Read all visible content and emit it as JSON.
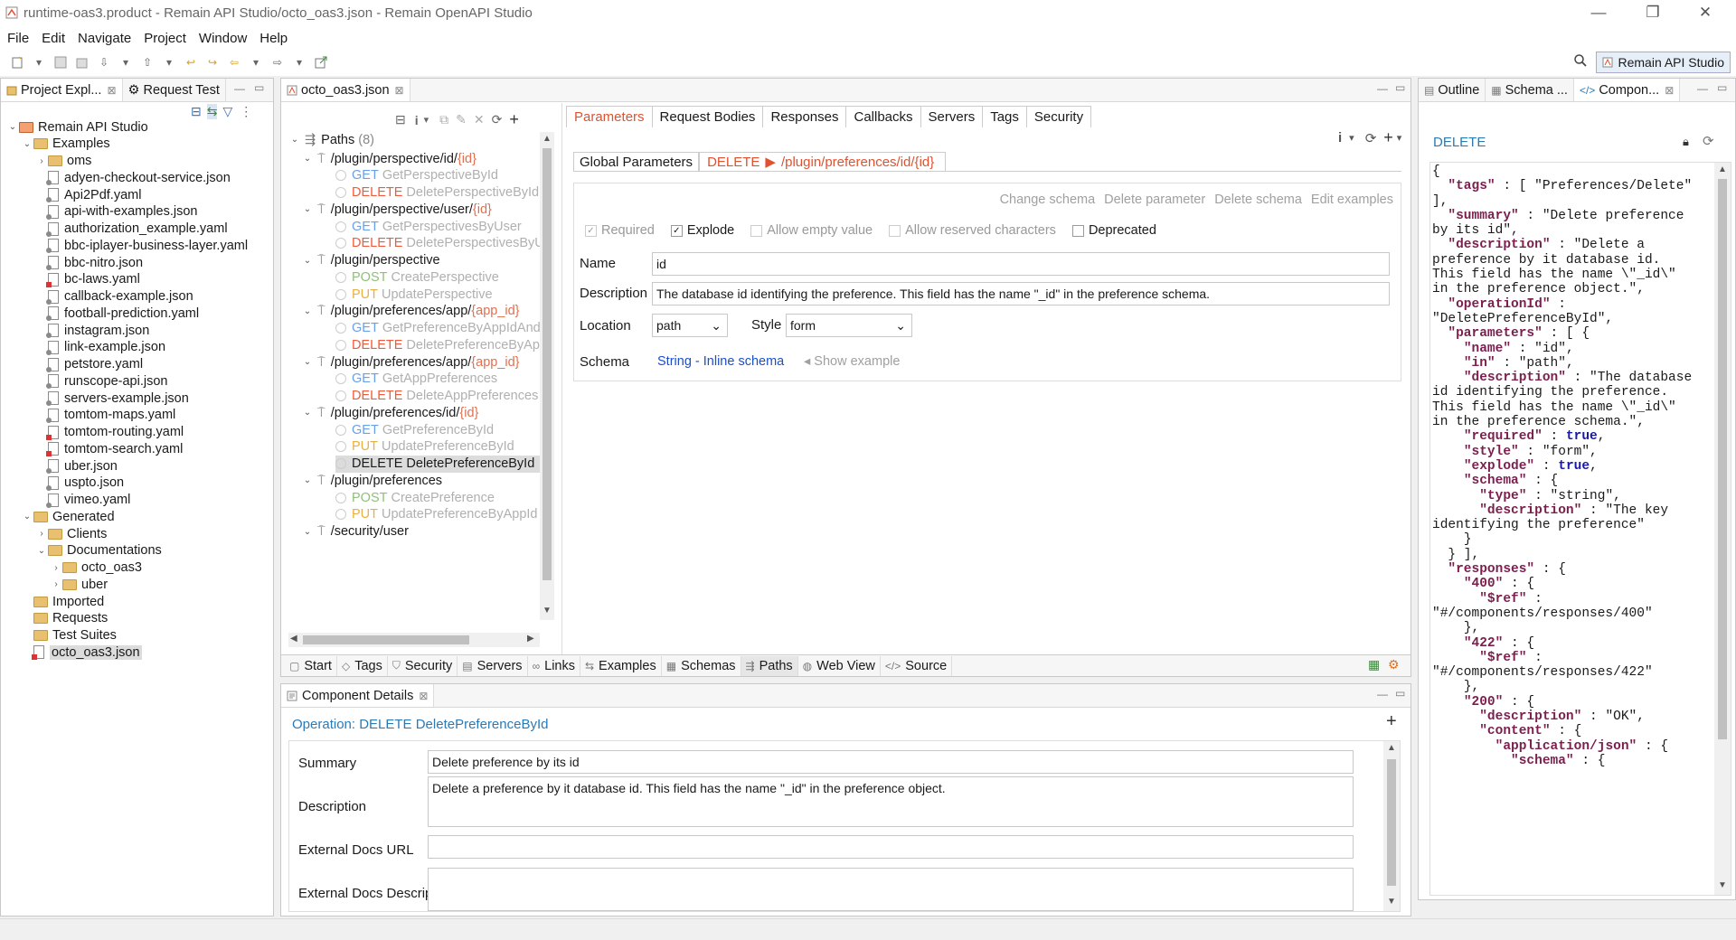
{
  "window": {
    "title": "runtime-oas3.product - Remain API Studio/octo_oas3.json - Remain OpenAPI Studio",
    "minimize": "—",
    "restore": "❐",
    "close": "✕"
  },
  "menu": [
    "File",
    "Edit",
    "Navigate",
    "Project",
    "Window",
    "Help"
  ],
  "perspective": "Remain API Studio",
  "left_panel": {
    "tabs": [
      {
        "label": "Project Expl...",
        "close": "⊠"
      },
      {
        "label": "Request Test"
      }
    ],
    "tree": [
      {
        "label": "Remain API Studio",
        "depth": 0,
        "kind": "project",
        "twist": "⌄"
      },
      {
        "label": "Examples",
        "depth": 1,
        "kind": "folder",
        "twist": "⌄"
      },
      {
        "label": "oms",
        "depth": 2,
        "kind": "folder",
        "twist": "›"
      },
      {
        "label": "adyen-checkout-service.json",
        "depth": 2,
        "kind": "swag"
      },
      {
        "label": "Api2Pdf.yaml",
        "depth": 2,
        "kind": "swag"
      },
      {
        "label": "api-with-examples.json",
        "depth": 2,
        "kind": "swag"
      },
      {
        "label": "authorization_example.yaml",
        "depth": 2,
        "kind": "swag"
      },
      {
        "label": "bbc-iplayer-business-layer.yaml",
        "depth": 2,
        "kind": "swag"
      },
      {
        "label": "bbc-nitro.json",
        "depth": 2,
        "kind": "swag"
      },
      {
        "label": "bc-laws.yaml",
        "depth": 2,
        "kind": "red"
      },
      {
        "label": "callback-example.json",
        "depth": 2,
        "kind": "swag"
      },
      {
        "label": "football-prediction.yaml",
        "depth": 2,
        "kind": "swag"
      },
      {
        "label": "instagram.json",
        "depth": 2,
        "kind": "swag"
      },
      {
        "label": "link-example.json",
        "depth": 2,
        "kind": "swag"
      },
      {
        "label": "petstore.yaml",
        "depth": 2,
        "kind": "swag"
      },
      {
        "label": "runscope-api.json",
        "depth": 2,
        "kind": "swag"
      },
      {
        "label": "servers-example.json",
        "depth": 2,
        "kind": "swag"
      },
      {
        "label": "tomtom-maps.yaml",
        "depth": 2,
        "kind": "swag"
      },
      {
        "label": "tomtom-routing.yaml",
        "depth": 2,
        "kind": "red"
      },
      {
        "label": "tomtom-search.yaml",
        "depth": 2,
        "kind": "red"
      },
      {
        "label": "uber.json",
        "depth": 2,
        "kind": "swag"
      },
      {
        "label": "uspto.json",
        "depth": 2,
        "kind": "swag"
      },
      {
        "label": "vimeo.yaml",
        "depth": 2,
        "kind": "swag"
      },
      {
        "label": "Generated",
        "depth": 1,
        "kind": "folder",
        "twist": "⌄"
      },
      {
        "label": "Clients",
        "depth": 2,
        "kind": "folder",
        "twist": "›"
      },
      {
        "label": "Documentations",
        "depth": 2,
        "kind": "folder",
        "twist": "⌄"
      },
      {
        "label": "octo_oas3",
        "depth": 3,
        "kind": "folder",
        "twist": "›"
      },
      {
        "label": "uber",
        "depth": 3,
        "kind": "folder",
        "twist": "›"
      },
      {
        "label": "Imported",
        "depth": 1,
        "kind": "folder"
      },
      {
        "label": "Requests",
        "depth": 1,
        "kind": "folder"
      },
      {
        "label": "Test Suites",
        "depth": 1,
        "kind": "folder"
      },
      {
        "label": "octo_oas3.json",
        "depth": 1,
        "kind": "red",
        "selected": true
      }
    ]
  },
  "editor": {
    "tab": "octo_oas3.json",
    "tab_close": "⊠",
    "paths_header": "Paths",
    "paths_count": "(8)",
    "paths": [
      {
        "type": "path",
        "prefix": "/plugin/perspective/id/",
        "param": "{id}"
      },
      {
        "type": "op",
        "method": "GET",
        "name": "GetPerspectiveById"
      },
      {
        "type": "op",
        "method": "DELETE",
        "name": "DeletePerspectiveById"
      },
      {
        "type": "path",
        "prefix": "/plugin/perspective/user/",
        "param": "{id}"
      },
      {
        "type": "op",
        "method": "GET",
        "name": "GetPerspectivesByUser"
      },
      {
        "type": "op",
        "method": "DELETE",
        "name": "DeletePerspectivesByUser"
      },
      {
        "type": "path",
        "prefix": "/plugin/perspective",
        "param": ""
      },
      {
        "type": "op",
        "method": "POST",
        "name": "CreatePerspective"
      },
      {
        "type": "op",
        "method": "PUT",
        "name": "UpdatePerspective"
      },
      {
        "type": "path",
        "prefix": "/plugin/preferences/app/",
        "param": "{app_id}"
      },
      {
        "type": "op",
        "method": "GET",
        "name": "GetPreferenceByAppIdAndKey"
      },
      {
        "type": "op",
        "method": "DELETE",
        "name": "DeletePreferenceByAppId"
      },
      {
        "type": "path",
        "prefix": "/plugin/preferences/app/",
        "param": "{app_id}"
      },
      {
        "type": "op",
        "method": "GET",
        "name": "GetAppPreferences"
      },
      {
        "type": "op",
        "method": "DELETE",
        "name": "DeleteAppPreferences"
      },
      {
        "type": "path",
        "prefix": "/plugin/preferences/id/",
        "param": "{id}"
      },
      {
        "type": "op",
        "method": "GET",
        "name": "GetPreferenceById"
      },
      {
        "type": "op",
        "method": "PUT",
        "name": "UpdatePreferenceById"
      },
      {
        "type": "op",
        "method": "DELETE",
        "name": "DeletePreferenceById",
        "selected": true
      },
      {
        "type": "path",
        "prefix": "/plugin/preferences",
        "param": ""
      },
      {
        "type": "op",
        "method": "POST",
        "name": "CreatePreference"
      },
      {
        "type": "op",
        "method": "PUT",
        "name": "UpdatePreferenceByAppId"
      },
      {
        "type": "path",
        "prefix": "/security/user",
        "param": ""
      }
    ],
    "section_tabs": [
      "Parameters",
      "Request Bodies",
      "Responses",
      "Callbacks",
      "Servers",
      "Tags",
      "Security"
    ],
    "crumb_global": "Global Parameters",
    "crumb_method": "DELETE",
    "crumb_arrow": "▶",
    "crumb_path": "/plugin/preferences/id/{id}",
    "actions": [
      "Change schema",
      "Delete parameter",
      "Delete schema",
      "Edit examples"
    ],
    "checks": [
      {
        "label": "Required",
        "checked": true,
        "disabled": true
      },
      {
        "label": "Explode",
        "checked": true,
        "disabled": false
      },
      {
        "label": "Allow empty value",
        "checked": false,
        "disabled": true
      },
      {
        "label": "Allow reserved characters",
        "checked": false,
        "disabled": true
      },
      {
        "label": "Deprecated",
        "checked": false,
        "disabled": false
      }
    ],
    "name_label": "Name",
    "name_value": "id",
    "desc_label": "Description",
    "desc_value": "The database id identifying the preference. This field has the name \"_id\" in the preference schema.",
    "location_label": "Location",
    "location_value": "path",
    "style_label": "Style",
    "style_value": "form",
    "schema_label": "Schema",
    "schema_link": "String - Inline schema",
    "show_example": "◂ Show example",
    "bottom_tabs": [
      {
        "label": "Start",
        "icon": "▢"
      },
      {
        "label": "Tags",
        "icon": "◇"
      },
      {
        "label": "Security",
        "icon": "⛉"
      },
      {
        "label": "Servers",
        "icon": "▤"
      },
      {
        "label": "Links",
        "icon": "∞"
      },
      {
        "label": "Examples",
        "icon": "⇆"
      },
      {
        "label": "Schemas",
        "icon": "▦"
      },
      {
        "label": "Paths",
        "icon": "⇶"
      },
      {
        "label": "Web View",
        "icon": "◍"
      },
      {
        "label": "Source",
        "icon": "</>"
      }
    ]
  },
  "component_details": {
    "tab": "Component Details",
    "tab_close": "⊠",
    "operation": "Operation: DELETE DeletePreferenceById",
    "add": "+",
    "summary_label": "Summary",
    "summary_value": "Delete preference by its id",
    "description_label": "Description",
    "description_value": "Delete a preference by it database id. This field has the name \"_id\" in the preference object.",
    "ext_url_label": "External Docs URL",
    "ext_url_value": "",
    "ext_desc_label": "External Docs Description",
    "ext_desc_value": ""
  },
  "right_panel": {
    "tabs": [
      {
        "label": "Outline"
      },
      {
        "label": "Schema ..."
      },
      {
        "label": "Compon...",
        "close": "⊠"
      }
    ],
    "header": "DELETE",
    "json_lines": [
      [
        [
          "p",
          "{"
        ]
      ],
      [
        [
          "p",
          "  "
        ],
        [
          "k",
          "\"tags\""
        ],
        [
          "p",
          " : [ \"Preferences/Delete\""
        ]
      ],
      [
        [
          "p",
          "],"
        ]
      ],
      [
        [
          "p",
          "  "
        ],
        [
          "k",
          "\"summary\""
        ],
        [
          "p",
          " : \"Delete preference"
        ]
      ],
      [
        [
          "p",
          "by its id\","
        ]
      ],
      [
        [
          "p",
          "  "
        ],
        [
          "k",
          "\"description\""
        ],
        [
          "p",
          " : \"Delete a"
        ]
      ],
      [
        [
          "p",
          "preference by it database id."
        ]
      ],
      [
        [
          "p",
          "This field has the name \\\"_id\\\""
        ]
      ],
      [
        [
          "p",
          "in the preference object.\","
        ]
      ],
      [
        [
          "p",
          "  "
        ],
        [
          "k",
          "\"operationId\""
        ],
        [
          "p",
          " :"
        ]
      ],
      [
        [
          "p",
          "\"DeletePreferenceById\","
        ]
      ],
      [
        [
          "p",
          "  "
        ],
        [
          "k",
          "\"parameters\""
        ],
        [
          "p",
          " : [ {"
        ]
      ],
      [
        [
          "p",
          "    "
        ],
        [
          "k",
          "\"name\""
        ],
        [
          "p",
          " : \"id\","
        ]
      ],
      [
        [
          "p",
          "    "
        ],
        [
          "k",
          "\"in\""
        ],
        [
          "p",
          " : \"path\","
        ]
      ],
      [
        [
          "p",
          "    "
        ],
        [
          "k",
          "\"description\""
        ],
        [
          "p",
          " : \"The database"
        ]
      ],
      [
        [
          "p",
          "id identifying the preference."
        ]
      ],
      [
        [
          "p",
          "This field has the name \\\"_id\\\""
        ]
      ],
      [
        [
          "p",
          "in the preference schema.\","
        ]
      ],
      [
        [
          "p",
          "    "
        ],
        [
          "k",
          "\"required\""
        ],
        [
          "p",
          " : "
        ],
        [
          "b",
          "true"
        ],
        [
          "p",
          ","
        ]
      ],
      [
        [
          "p",
          "    "
        ],
        [
          "k",
          "\"style\""
        ],
        [
          "p",
          " : \"form\","
        ]
      ],
      [
        [
          "p",
          "    "
        ],
        [
          "k",
          "\"explode\""
        ],
        [
          "p",
          " : "
        ],
        [
          "b",
          "true"
        ],
        [
          "p",
          ","
        ]
      ],
      [
        [
          "p",
          "    "
        ],
        [
          "k",
          "\"schema\""
        ],
        [
          "p",
          " : {"
        ]
      ],
      [
        [
          "p",
          "      "
        ],
        [
          "k",
          "\"type\""
        ],
        [
          "p",
          " : \"string\","
        ]
      ],
      [
        [
          "p",
          "      "
        ],
        [
          "k",
          "\"description\""
        ],
        [
          "p",
          " : \"The key"
        ]
      ],
      [
        [
          "p",
          "identifying the preference\""
        ]
      ],
      [
        [
          "p",
          "    }"
        ]
      ],
      [
        [
          "p",
          "  } ],"
        ]
      ],
      [
        [
          "p",
          "  "
        ],
        [
          "k",
          "\"responses\""
        ],
        [
          "p",
          " : {"
        ]
      ],
      [
        [
          "p",
          "    "
        ],
        [
          "k",
          "\"400\""
        ],
        [
          "p",
          " : {"
        ]
      ],
      [
        [
          "p",
          "      "
        ],
        [
          "k",
          "\"$ref\""
        ],
        [
          "p",
          " :"
        ]
      ],
      [
        [
          "p",
          "\"#/components/responses/400\""
        ]
      ],
      [
        [
          "p",
          "    },"
        ]
      ],
      [
        [
          "p",
          "    "
        ],
        [
          "k",
          "\"422\""
        ],
        [
          "p",
          " : {"
        ]
      ],
      [
        [
          "p",
          "      "
        ],
        [
          "k",
          "\"$ref\""
        ],
        [
          "p",
          " :"
        ]
      ],
      [
        [
          "p",
          "\"#/components/responses/422\""
        ]
      ],
      [
        [
          "p",
          "    },"
        ]
      ],
      [
        [
          "p",
          "    "
        ],
        [
          "k",
          "\"200\""
        ],
        [
          "p",
          " : {"
        ]
      ],
      [
        [
          "p",
          "      "
        ],
        [
          "k",
          "\"description\""
        ],
        [
          "p",
          " : \"OK\","
        ]
      ],
      [
        [
          "p",
          "      "
        ],
        [
          "k",
          "\"content\""
        ],
        [
          "p",
          " : {"
        ]
      ],
      [
        [
          "p",
          "        "
        ],
        [
          "k",
          "\"application/json\""
        ],
        [
          "p",
          " : {"
        ]
      ],
      [
        [
          "p",
          "          "
        ],
        [
          "k",
          "\"schema\""
        ],
        [
          "p",
          " : {"
        ]
      ]
    ]
  },
  "colors": {
    "accent_red": "#e0522f",
    "get": "#6aa0e8",
    "delete": "#f05a3a",
    "post": "#8fc07a",
    "put": "#e8b040",
    "link": "#1a50c8",
    "json_key": "#7a1f4e",
    "json_bool": "#1a1aa6"
  }
}
